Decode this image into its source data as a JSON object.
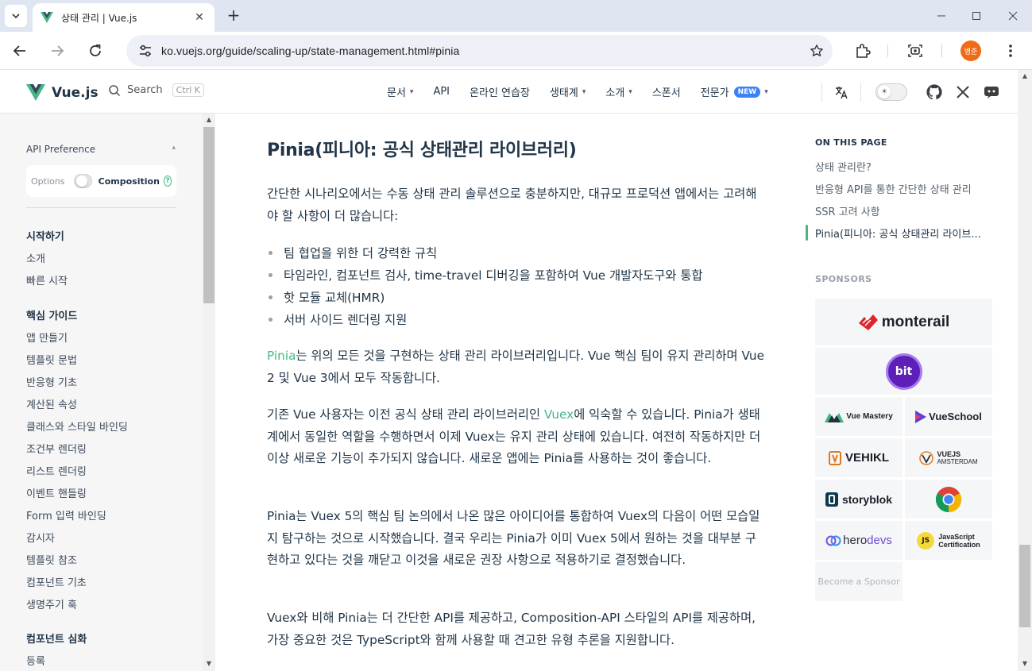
{
  "browser": {
    "tab_title": "상태 관리 | Vue.js",
    "url": "ko.vuejs.org/guide/scaling-up/state-management.html#pinia",
    "profile_initials": "병준"
  },
  "site": {
    "logo_text": "Vue.js",
    "search_label": "Search",
    "search_shortcut": "Ctrl K",
    "nav": {
      "docs": "문서",
      "api": "API",
      "playground": "온라인 연습장",
      "ecosystem": "생태계",
      "about": "소개",
      "sponsor": "스폰서",
      "partners": "전문가",
      "new_badge": "NEW"
    }
  },
  "sidebar": {
    "api_preference": "API Preference",
    "options_label": "Options",
    "composition_label": "Composition",
    "groups": [
      {
        "title": "시작하기",
        "items": [
          "소개",
          "빠른 시작"
        ]
      },
      {
        "title": "핵심 가이드",
        "items": [
          "앱 만들기",
          "템플릿 문법",
          "반응형 기초",
          "계산된 속성",
          "클래스와 스타일 바인딩",
          "조건부 렌더링",
          "리스트 렌더링",
          "이벤트 핸들링",
          "Form 입력 바인딩",
          "감시자",
          "템플릿 참조",
          "컴포넌트 기초",
          "생명주기 훅"
        ]
      },
      {
        "title": "컴포넌트 심화",
        "items": [
          "등록"
        ]
      }
    ]
  },
  "content": {
    "heading": "Pinia(피니아: 공식 상태관리 라이브러리)",
    "p1": "간단한 시나리오에서는 수동 상태 관리 솔루션으로 충분하지만, 대규모 프로덕션 앱에서는 고려해야 할 사항이 더 많습니다:",
    "bullets": [
      "팀 협업을 위한 더 강력한 규칙",
      "타임라인, 컴포넌트 검사, time-travel 디버깅을 포함하여 Vue 개발자도구와 통합",
      "핫 모듈 교체(HMR)",
      "서버 사이드 렌더링 지원"
    ],
    "p2_link": "Pinia",
    "p2_rest": "는 위의 모든 것을 구현하는 상태 관리 라이브러리입니다. Vue 핵심 팀이 유지 관리하며 Vue 2 및 Vue 3에서 모두 작동합니다.",
    "p3_before": "기존 Vue 사용자는 이전 공식 상태 관리 라이브러리인 ",
    "p3_link": "Vuex",
    "p3_after": "에 익숙할 수 있습니다. Pinia가 생태계에서 동일한 역할을 수행하면서 이제 Vuex는 유지 관리 상태에 있습니다. 여전히 작동하지만 더 이상 새로운 기능이 추가되지 않습니다. 새로운 앱에는 Pinia를 사용하는 것이 좋습니다.",
    "p4": "Pinia는 Vuex 5의 핵심 팀 논의에서 나온 많은 아이디어를 통합하여 Vuex의 다음이 어떤 모습일지 탐구하는 것으로 시작했습니다. 결국 우리는 Pinia가 이미 Vuex 5에서 원하는 것을 대부분 구현하고 있다는 것을 깨닫고 이것을 새로운 권장 사항으로 적용하기로 결정했습니다.",
    "p5": "Vuex와 비해 Pinia는 더 간단한 API를 제공하고, Composition-API 스타일의 API를 제공하며, 가장 중요한 것은 TypeScript와 함께 사용할 때 견고한 유형 추론을 지원합니다."
  },
  "aside": {
    "on_this_page": "ON THIS PAGE",
    "items": [
      "상태 관리란?",
      "반응형 API를 통한 간단한 상태 관리",
      "SSR 고려 사항",
      "Pinia(피니아: 공식 상태관리 라이브..."
    ],
    "sponsors_title": "SPONSORS",
    "sponsors": {
      "monterail": "monterail",
      "bit": "bit",
      "vue_mastery": "Vue Mastery",
      "vue_school": "VueSchool",
      "vehikl": "VEHIKL",
      "vuejs_amsterdam_1": "VUEJS",
      "vuejs_amsterdam_2": "AMSTERDAM",
      "storyblok": "storyblok",
      "herodevs_1": "hero",
      "herodevs_2": "devs",
      "js_cert_1": "JavaScript",
      "js_cert_2": "Certification",
      "js_badge": "JS",
      "become": "Become a Sponsor"
    }
  },
  "colors": {
    "vue_green": "#42b883",
    "vue_dark": "#35495e",
    "text": "#213547",
    "new_badge": "#3b82f6",
    "avatar": "#f06b18"
  }
}
